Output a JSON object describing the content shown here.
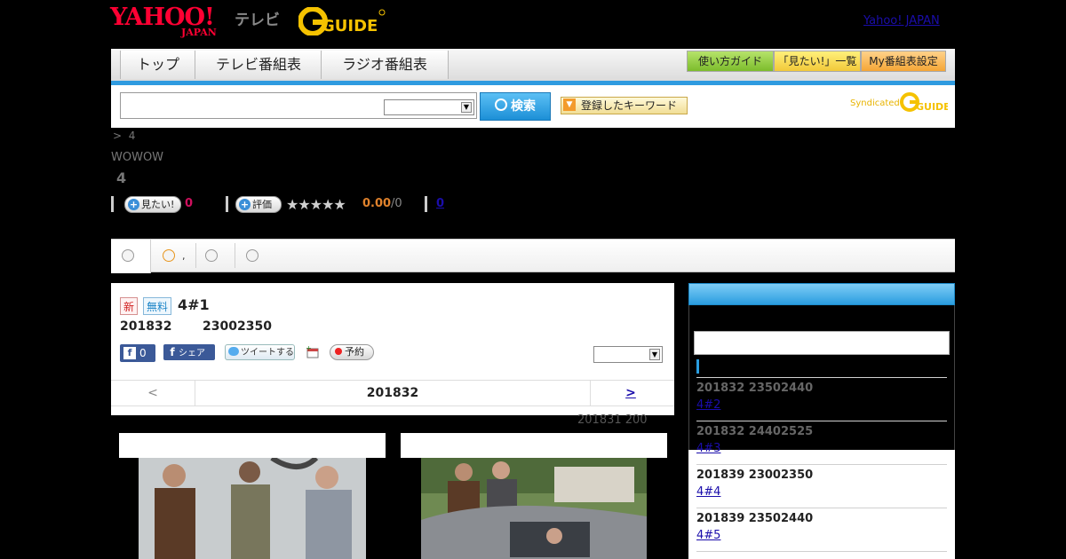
{
  "header": {
    "yahoo_logo_text": "YAHOO!",
    "yahoo_logo_sub": "JAPAN",
    "tv_label": "テレビ",
    "gguide_logo_text": "GUIDE",
    "yahoo_japan_link": "Yahoo! JAPAN"
  },
  "nav": {
    "tabs": [
      {
        "label": "トップ"
      },
      {
        "label": "テレビ番組表"
      },
      {
        "label": "ラジオ番組表"
      }
    ],
    "right_buttons": [
      {
        "label": "使い方ガイド",
        "color": "#8cc63f"
      },
      {
        "label": "「見たい!」一覧",
        "color": "#f7d94c"
      },
      {
        "label": "My番組表設定",
        "color": "#f5a636"
      }
    ]
  },
  "search": {
    "input_value": "",
    "select_value": "",
    "button_label": "検索",
    "keyword_button_label": "登録したキーワード",
    "syndicated_label": "Syndicated"
  },
  "program": {
    "breadcrumb_sep": ">",
    "breadcrumb_item": "4",
    "channel": "WOWOW",
    "title": "4",
    "want_button": "見たい!",
    "want_count": "0",
    "rate_button": "評価",
    "rating_value": "0.00",
    "rating_count": "/0",
    "stars": 0,
    "max_stars": 5,
    "review_link": "0"
  },
  "tabbar": {
    "items": [
      "",
      ",",
      "",
      ""
    ]
  },
  "episode": {
    "tag_new": "新",
    "tag_free": "無料",
    "title": "4#1",
    "date": "201832",
    "time": "23002350",
    "fb_count": "0",
    "fb_share": "シェア",
    "tweet": "ツイートする",
    "reserve": "予約",
    "select_value": "",
    "pager_prev": "<",
    "pager_current": "201832",
    "pager_next": ">",
    "date_note": "201831  200"
  },
  "sidebar": {
    "items": [
      {
        "time": "201832  23502440",
        "link": "4#2"
      },
      {
        "time": "201832  24402525",
        "link": "4#3"
      },
      {
        "time": "201839  23002350",
        "link": "4#4"
      },
      {
        "time": "201839  23502440",
        "link": "4#5"
      }
    ]
  },
  "colors": {
    "accent_blue": "#2a9ddf",
    "yahoo_red": "#ff0033",
    "gguide_yellow": "#f5c200",
    "rating_orange": "#e0822c",
    "want_pink": "#d0105e"
  }
}
